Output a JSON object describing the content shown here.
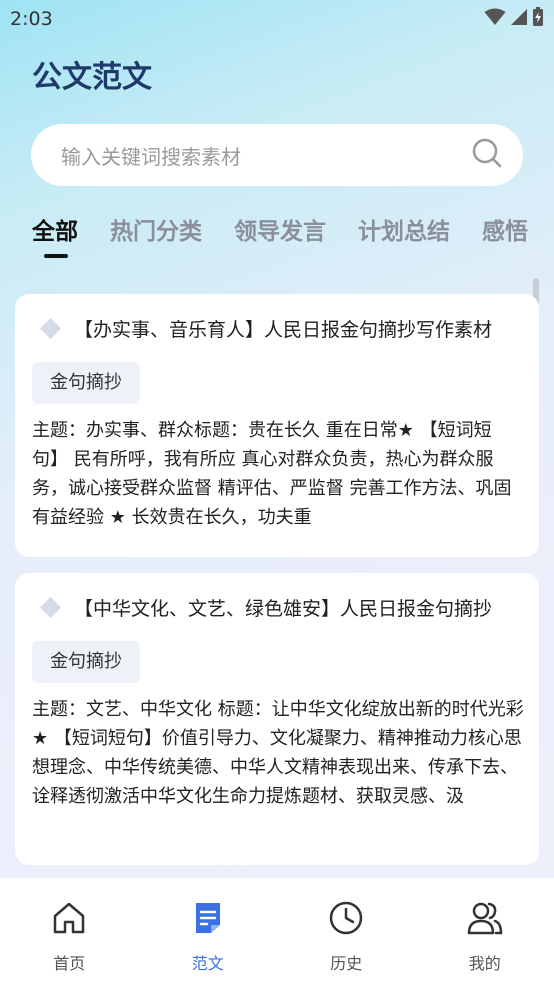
{
  "status_bar": {
    "time": "2:03"
  },
  "header": {
    "title": "公文范文"
  },
  "search": {
    "placeholder": "输入关键词搜索素材"
  },
  "tabs": [
    {
      "label": "全部",
      "active": true
    },
    {
      "label": "热门分类",
      "active": false
    },
    {
      "label": "领导发言",
      "active": false
    },
    {
      "label": "计划总结",
      "active": false
    },
    {
      "label": "感悟",
      "active": false
    }
  ],
  "cards": [
    {
      "title": "【办实事、音乐育人】人民日报金句摘抄写作素材",
      "tag": "金句摘抄",
      "body": "主题：办实事、群众标题：贵在长久 重在日常★ 【短词短句】 民有所呼，我有所应 真心对群众负责，热心为群众服务，诚心接受群众监督 精评估、严监督 完善工作方法、巩固有益经验 ★ 长效贵在长久，功夫重"
    },
    {
      "title": "【中华文化、文艺、绿色雄安】人民日报金句摘抄",
      "tag": "金句摘抄",
      "body": "主题：文艺、中华文化 标题：让中华文化绽放出新的时代光彩 ★ 【短词短句】价值引导力、文化凝聚力、精神推动力核心思想理念、中华传统美德、中华人文精神表现出来、传承下去、诠释透彻激活中华文化生命力提炼题材、获取灵感、汲"
    }
  ],
  "bottom_nav": [
    {
      "label": "首页",
      "icon": "home-icon",
      "active": false
    },
    {
      "label": "范文",
      "icon": "document-icon",
      "active": true
    },
    {
      "label": "历史",
      "icon": "clock-icon",
      "active": false
    },
    {
      "label": "我的",
      "icon": "users-icon",
      "active": false
    }
  ],
  "colors": {
    "accent": "#3a6fe6",
    "title": "#1f3a6a"
  }
}
